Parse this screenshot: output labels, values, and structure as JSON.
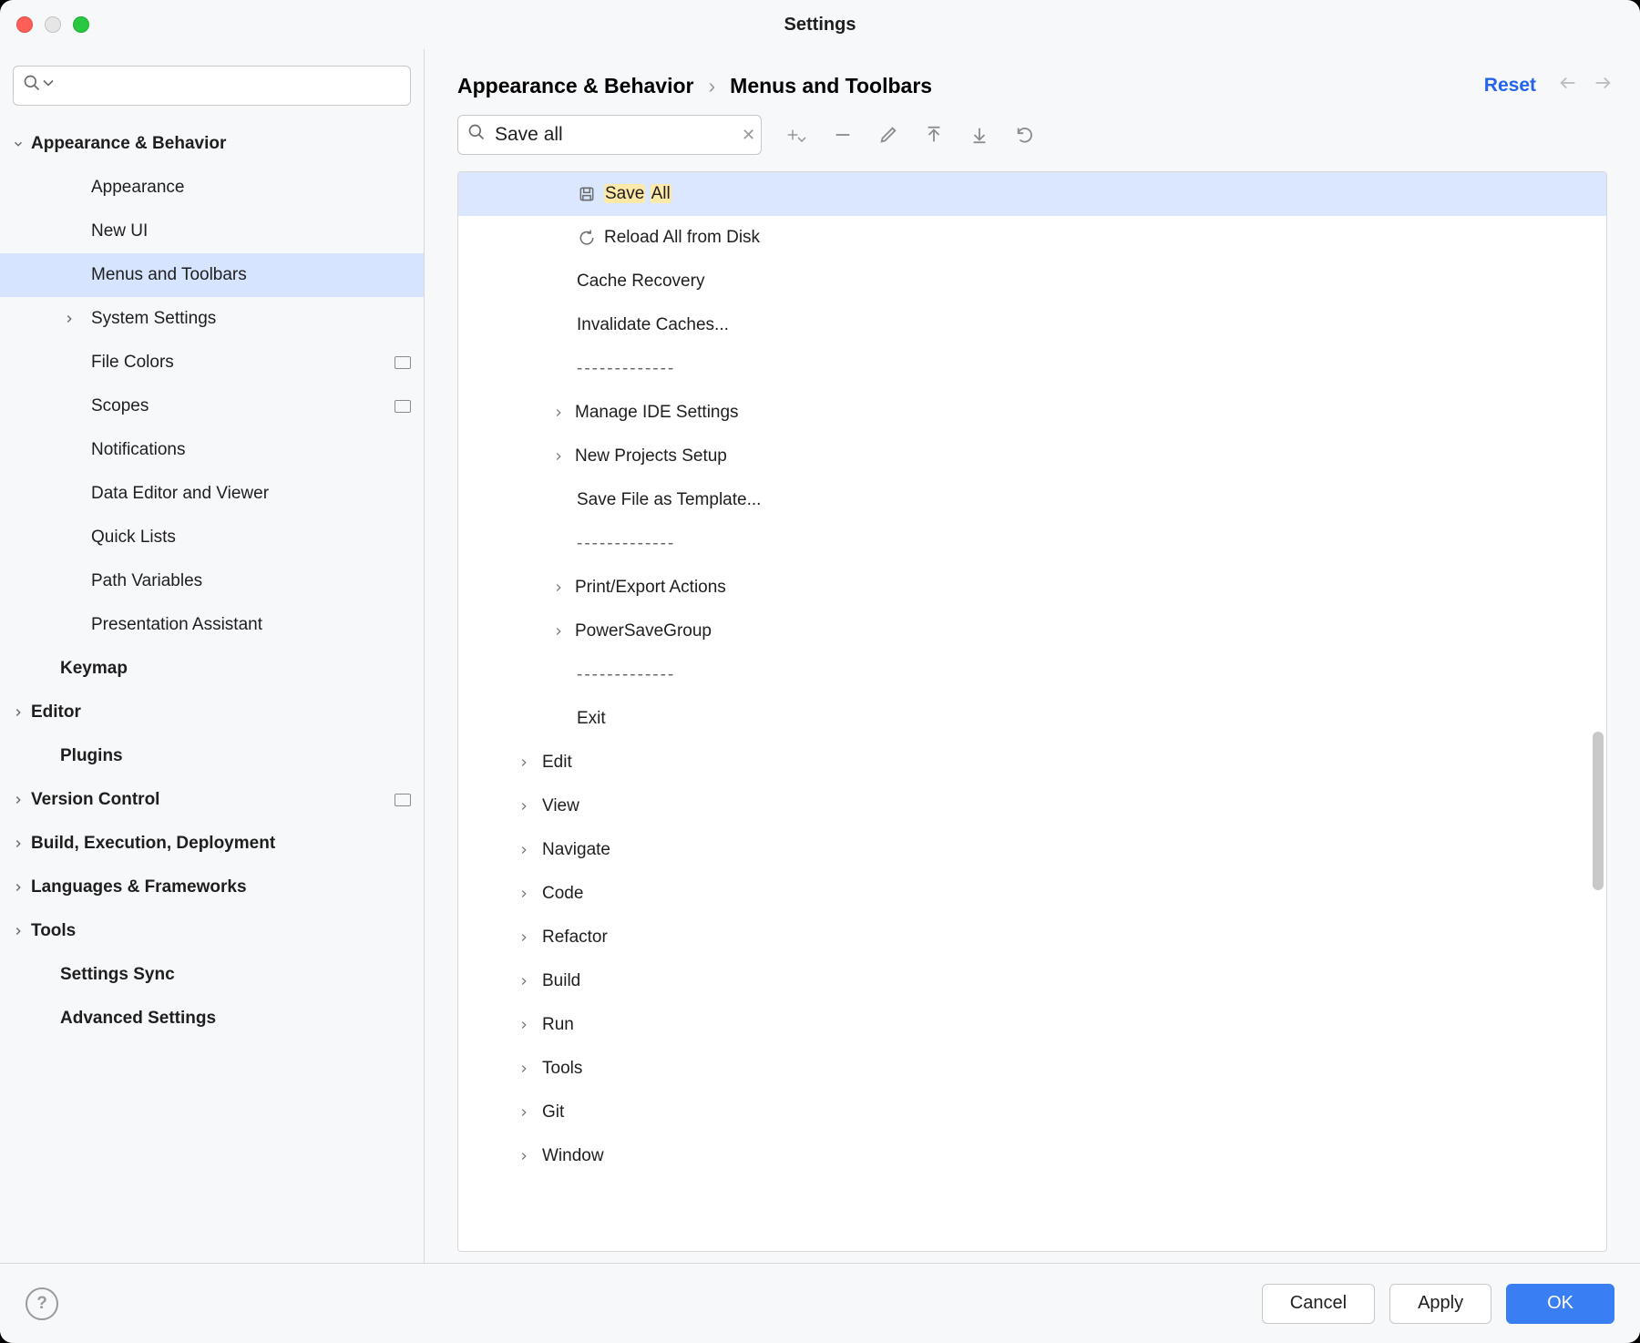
{
  "window": {
    "title": "Settings"
  },
  "sidebar": {
    "search_placeholder": "",
    "items": [
      {
        "label": "Appearance & Behavior",
        "bold": true,
        "indent": 0,
        "chev": "down",
        "selected": false
      },
      {
        "label": "Appearance",
        "bold": false,
        "indent": 1,
        "chev": null,
        "selected": false
      },
      {
        "label": "New UI",
        "bold": false,
        "indent": 1,
        "chev": null,
        "selected": false
      },
      {
        "label": "Menus and Toolbars",
        "bold": false,
        "indent": 1,
        "chev": null,
        "selected": true
      },
      {
        "label": "System Settings",
        "bold": false,
        "indent": 1,
        "chev": "right",
        "selected": false
      },
      {
        "label": "File Colors",
        "bold": false,
        "indent": 1,
        "chev": null,
        "selected": false,
        "tag": true
      },
      {
        "label": "Scopes",
        "bold": false,
        "indent": 1,
        "chev": null,
        "selected": false,
        "tag": true
      },
      {
        "label": "Notifications",
        "bold": false,
        "indent": 1,
        "chev": null,
        "selected": false
      },
      {
        "label": "Data Editor and Viewer",
        "bold": false,
        "indent": 1,
        "chev": null,
        "selected": false
      },
      {
        "label": "Quick Lists",
        "bold": false,
        "indent": 1,
        "chev": null,
        "selected": false
      },
      {
        "label": "Path Variables",
        "bold": false,
        "indent": 1,
        "chev": null,
        "selected": false
      },
      {
        "label": "Presentation Assistant",
        "bold": false,
        "indent": 1,
        "chev": null,
        "selected": false
      },
      {
        "label": "Keymap",
        "bold": true,
        "indent": 0,
        "chev": null,
        "selected": false
      },
      {
        "label": "Editor",
        "bold": true,
        "indent": 0,
        "chev": "right",
        "selected": false
      },
      {
        "label": "Plugins",
        "bold": true,
        "indent": 0,
        "chev": null,
        "selected": false
      },
      {
        "label": "Version Control",
        "bold": true,
        "indent": 0,
        "chev": "right",
        "selected": false,
        "tag": true
      },
      {
        "label": "Build, Execution, Deployment",
        "bold": true,
        "indent": 0,
        "chev": "right",
        "selected": false
      },
      {
        "label": "Languages & Frameworks",
        "bold": true,
        "indent": 0,
        "chev": "right",
        "selected": false
      },
      {
        "label": "Tools",
        "bold": true,
        "indent": 0,
        "chev": "right",
        "selected": false
      },
      {
        "label": "Settings Sync",
        "bold": true,
        "indent": 0,
        "chev": null,
        "selected": false
      },
      {
        "label": "Advanced Settings",
        "bold": true,
        "indent": 0,
        "chev": null,
        "selected": false
      }
    ]
  },
  "breadcrumb": {
    "part1": "Appearance & Behavior",
    "sep": "›",
    "part2": "Menus and Toolbars"
  },
  "reset_label": "Reset",
  "filter": {
    "value": "Save all"
  },
  "menu_tree": [
    {
      "indent": 3,
      "chev": null,
      "icon": "save",
      "label": "Save All",
      "selected": true,
      "highlight": "Save All"
    },
    {
      "indent": 3,
      "chev": null,
      "icon": "reload",
      "label": "Reload All from Disk"
    },
    {
      "indent": 3,
      "chev": null,
      "icon": null,
      "label": "Cache Recovery"
    },
    {
      "indent": 3,
      "chev": null,
      "icon": null,
      "label": "Invalidate Caches..."
    },
    {
      "indent": 3,
      "chev": null,
      "icon": null,
      "label": "-------------",
      "sep": true
    },
    {
      "indent": 3,
      "chev": "right",
      "icon": null,
      "label": "Manage IDE Settings"
    },
    {
      "indent": 3,
      "chev": "right",
      "icon": null,
      "label": "New Projects Setup"
    },
    {
      "indent": 3,
      "chev": null,
      "icon": null,
      "label": "Save File as Template..."
    },
    {
      "indent": 3,
      "chev": null,
      "icon": null,
      "label": "-------------",
      "sep": true
    },
    {
      "indent": 3,
      "chev": "right",
      "icon": null,
      "label": "Print/Export Actions"
    },
    {
      "indent": 3,
      "chev": "right",
      "icon": null,
      "label": "PowerSaveGroup"
    },
    {
      "indent": 3,
      "chev": null,
      "icon": null,
      "label": "-------------",
      "sep": true
    },
    {
      "indent": 3,
      "chev": null,
      "icon": null,
      "label": "Exit"
    },
    {
      "indent": 2,
      "chev": "right",
      "icon": null,
      "label": "Edit"
    },
    {
      "indent": 2,
      "chev": "right",
      "icon": null,
      "label": "View"
    },
    {
      "indent": 2,
      "chev": "right",
      "icon": null,
      "label": "Navigate"
    },
    {
      "indent": 2,
      "chev": "right",
      "icon": null,
      "label": "Code"
    },
    {
      "indent": 2,
      "chev": "right",
      "icon": null,
      "label": "Refactor"
    },
    {
      "indent": 2,
      "chev": "right",
      "icon": null,
      "label": "Build"
    },
    {
      "indent": 2,
      "chev": "right",
      "icon": null,
      "label": "Run"
    },
    {
      "indent": 2,
      "chev": "right",
      "icon": null,
      "label": "Tools"
    },
    {
      "indent": 2,
      "chev": "right",
      "icon": null,
      "label": "Git"
    },
    {
      "indent": 2,
      "chev": "right",
      "icon": null,
      "label": "Window"
    }
  ],
  "footer": {
    "cancel": "Cancel",
    "apply": "Apply",
    "ok": "OK"
  }
}
